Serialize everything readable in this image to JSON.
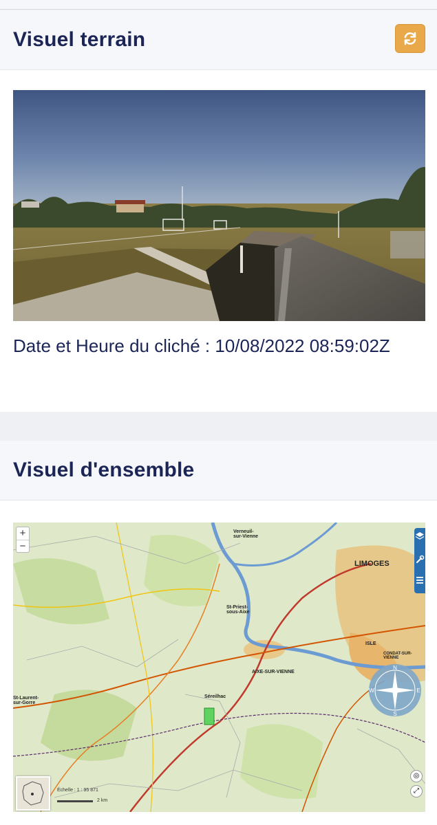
{
  "section_terrain": {
    "title": "Visuel terrain",
    "caption": "Date et Heure du cliché : 10/08/2022 08:59:02Z"
  },
  "section_ensemble": {
    "title": "Visuel d'ensemble"
  },
  "map": {
    "zoom_in": "+",
    "zoom_out": "−",
    "labels": {
      "limoges": "LIMOGES",
      "aixe": "AIXE-SUR-VIENNE",
      "st_laurent": "St-Laurent-sur-Gorre",
      "verneuil": "Verneuil-sur-Vienne",
      "isle": "ISLE",
      "condat": "CONDAT-SUR-VIENNE",
      "sereilhac": "Séreilhac",
      "st_priest": "St-Priest-sous-Aixe"
    },
    "scale_text": "Échelle : 1 : 95 871",
    "scale_bar_label": "2 km",
    "compass": {
      "n": "N",
      "s": "S",
      "e": "E",
      "w": "W"
    }
  },
  "colors": {
    "title": "#1b2556",
    "refresh_button": "#e9a94b",
    "header_bg": "#f6f7fa"
  }
}
